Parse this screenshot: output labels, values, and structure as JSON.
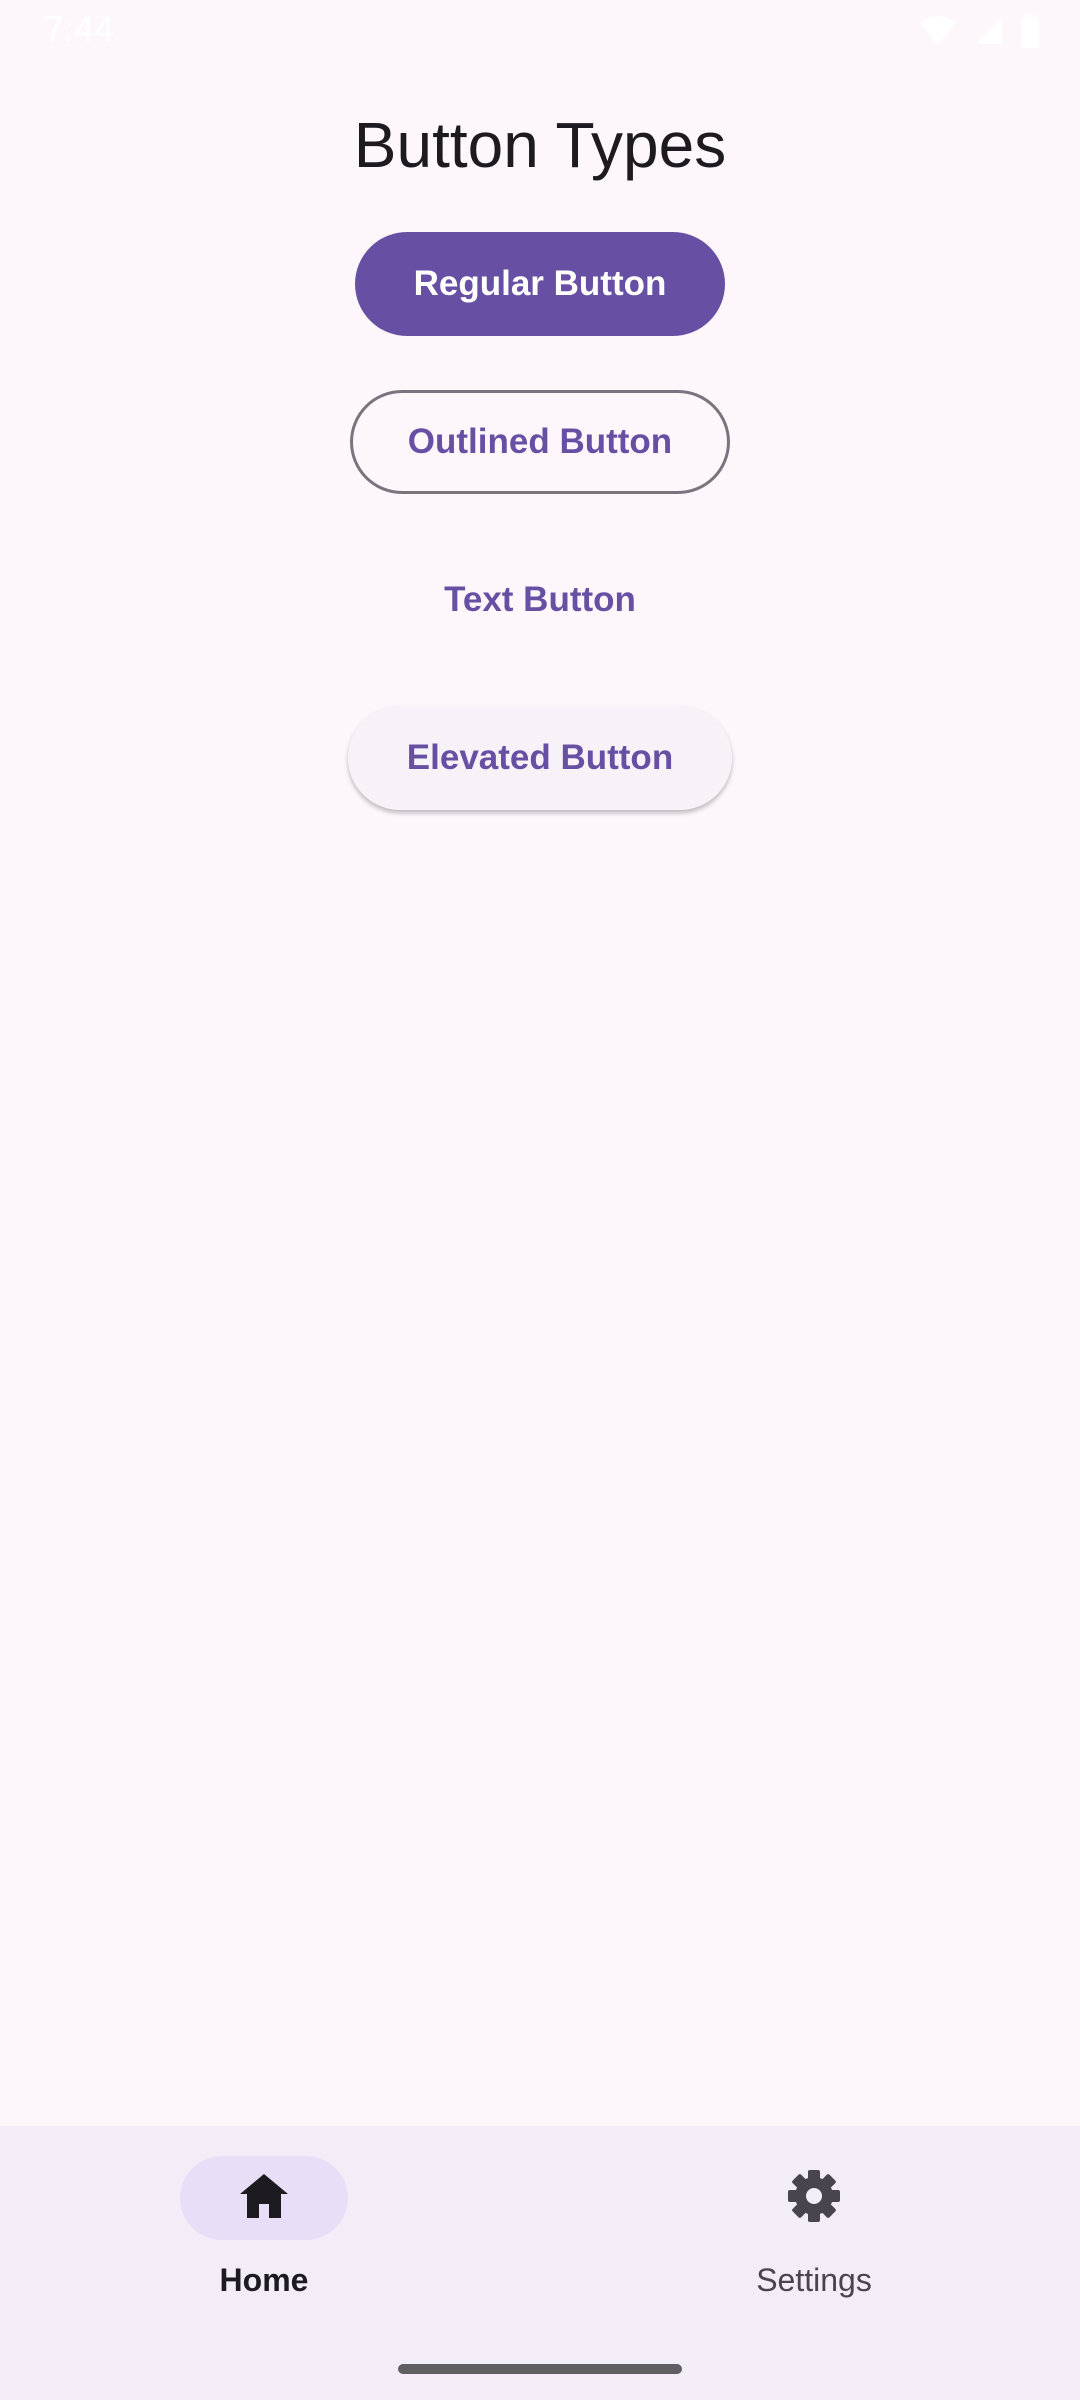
{
  "status_bar": {
    "time": "7:44",
    "icons": [
      "wifi-icon",
      "signal-icon",
      "battery-icon"
    ]
  },
  "page": {
    "title": "Button Types"
  },
  "buttons": {
    "regular": "Regular Button",
    "outlined": "Outlined Button",
    "text": "Text Button",
    "elevated": "Elevated Button"
  },
  "nav": {
    "items": [
      {
        "label": "Home",
        "icon": "home-icon",
        "selected": true
      },
      {
        "label": "Settings",
        "icon": "gear-icon",
        "selected": false
      }
    ]
  },
  "colors": {
    "primary": "#6750A4",
    "background": "#FDF7FC",
    "nav_background": "#F3EDF7",
    "nav_indicator": "#E8DEF8",
    "outline": "#79747E"
  }
}
